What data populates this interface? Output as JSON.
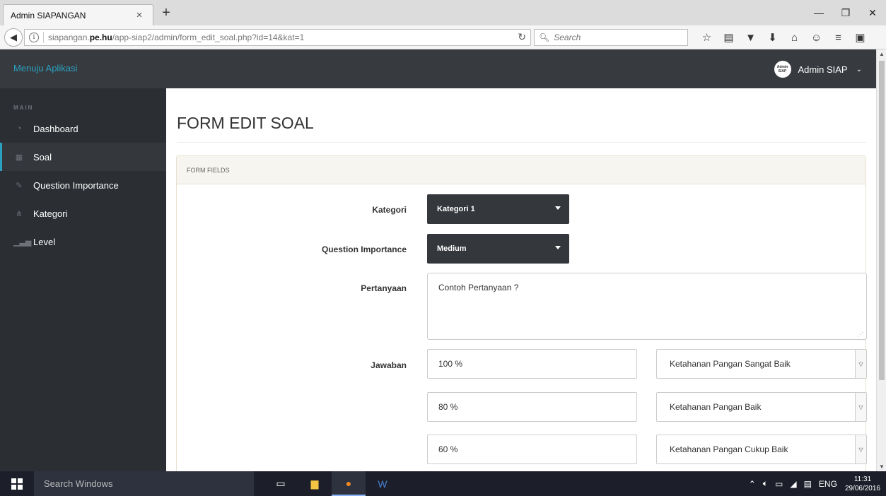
{
  "browser": {
    "tab_title": "Admin SIAPANGAN",
    "tab_close": "×",
    "new_tab": "+",
    "url_prefix": "siapangan.",
    "url_domain": "pe.hu",
    "url_path": "/app-siap2/admin/form_edit_soal.php?id=14&kat=1",
    "search_placeholder": "Search",
    "window_controls": [
      "—",
      "❐",
      "✕"
    ]
  },
  "header": {
    "brand": "Menuju Aplikasi",
    "avatar_line1": "Admin",
    "avatar_line2": "SIAP",
    "user_name": "Admin SIAP"
  },
  "sidebar": {
    "heading": "MAIN",
    "items": [
      {
        "label": "Dashboard",
        "icon": "dashboard-icon"
      },
      {
        "label": "Soal",
        "icon": "table-icon"
      },
      {
        "label": "Question Importance",
        "icon": "edit-icon"
      },
      {
        "label": "Kategori",
        "icon": "sitemap-icon"
      },
      {
        "label": "Level",
        "icon": "signal-icon"
      }
    ]
  },
  "main": {
    "title": "FORM EDIT SOAL",
    "panel_heading": "FORM FIELDS",
    "fields": {
      "kategori_label": "Kategori",
      "kategori_value": "Kategori 1",
      "importance_label": "Question Importance",
      "importance_value": "Medium",
      "pertanyaan_label": "Pertanyaan",
      "pertanyaan_value": "Contoh Pertanyaan ?",
      "jawaban_label": "Jawaban"
    },
    "jawaban": [
      {
        "value": "100 %",
        "option": "Ketahanan Pangan Sangat Baik"
      },
      {
        "value": "80 %",
        "option": "Ketahanan Pangan Baik"
      },
      {
        "value": "60 %",
        "option": "Ketahanan Pangan Cukup Baik"
      }
    ]
  },
  "taskbar": {
    "search_text": "Search Windows",
    "language": "ENG",
    "time": "11:31",
    "date": "29/06/2016"
  },
  "colors": {
    "accent": "#2aa1c0",
    "header_bg": "#373a3f",
    "sidebar_bg": "#2b2e33",
    "dark_select_bg": "#34373c"
  }
}
